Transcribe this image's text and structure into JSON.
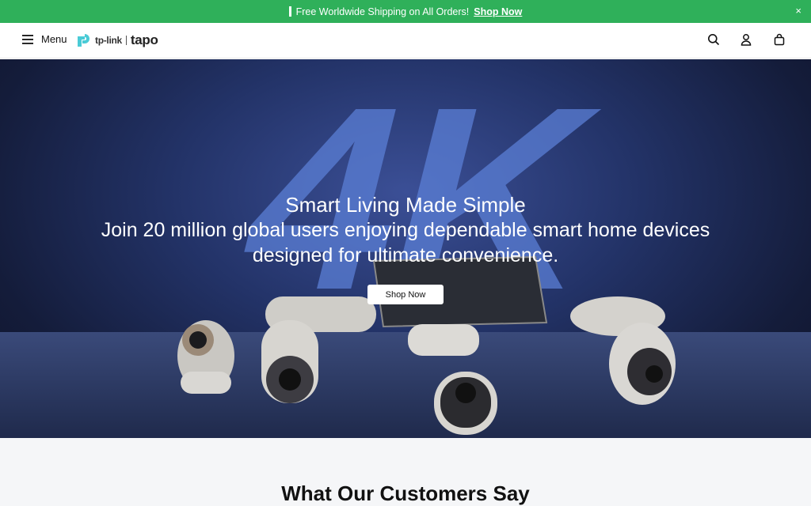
{
  "announcement": {
    "text": "Free Worldwide Shipping on All Orders!",
    "link": "Shop Now",
    "close": "×",
    "bg_color": "#2fb05a"
  },
  "header": {
    "menu_label": "Menu",
    "logo": {
      "brand": "tp-link",
      "product": "tapo"
    },
    "icons": [
      "search-icon",
      "account-icon",
      "cart-icon"
    ]
  },
  "hero": {
    "backdrop_text": "4K",
    "title": "Smart Living Made Simple",
    "subtitle": "Join 20 million global users enjoying dependable smart home devices designed for ultimate convenience.",
    "button": "Shop Now"
  },
  "section": {
    "title": "What Our Customers Say"
  }
}
